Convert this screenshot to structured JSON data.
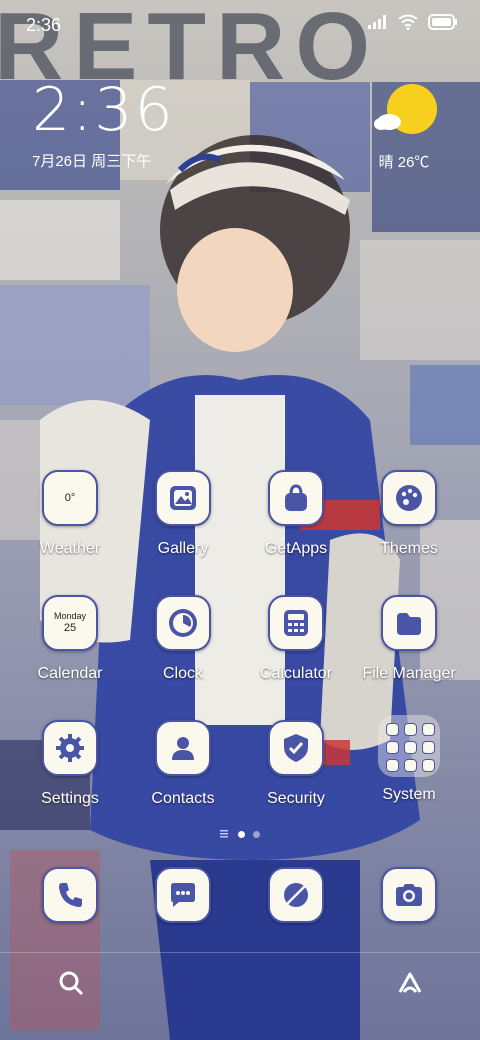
{
  "status_bar": {
    "time": "2:36",
    "icons": [
      "signal-icon",
      "wifi-icon",
      "battery-icon"
    ]
  },
  "wallpaper": {
    "headline": "RETRO"
  },
  "clock_widget": {
    "time": "2:36",
    "date": "7月26日 周三下午"
  },
  "weather_widget": {
    "text": "晴 26℃",
    "icon": "sun-cloud-icon"
  },
  "apps": [
    {
      "label": "Weather",
      "icon": "weather-icon",
      "inner": "0°"
    },
    {
      "label": "Gallery",
      "icon": "gallery-icon"
    },
    {
      "label": "GetApps",
      "icon": "shopping-bag-icon"
    },
    {
      "label": "Themes",
      "icon": "palette-icon"
    },
    {
      "label": "Calendar",
      "icon": "calendar-icon",
      "day": "Monday",
      "date": "25"
    },
    {
      "label": "Clock",
      "icon": "clock-icon"
    },
    {
      "label": "Calculator",
      "icon": "calculator-icon"
    },
    {
      "label": "File Manager",
      "icon": "folder-icon"
    },
    {
      "label": "Settings",
      "icon": "gear-icon"
    },
    {
      "label": "Contacts",
      "icon": "contacts-icon"
    },
    {
      "label": "Security",
      "icon": "shield-icon"
    },
    {
      "label": "System",
      "icon": "folder-grid-icon"
    }
  ],
  "dock": [
    {
      "name": "phone",
      "icon": "phone-icon"
    },
    {
      "name": "messages",
      "icon": "message-icon"
    },
    {
      "name": "browser",
      "icon": "browser-icon"
    },
    {
      "name": "camera",
      "icon": "camera-icon"
    }
  ],
  "bottom_bar": {
    "left": "search-icon",
    "right": "app-vault-icon"
  },
  "colors": {
    "icon_accent": "#4a55a8",
    "icon_bg": "#fbf8ee",
    "sun": "#f7cf1f"
  }
}
